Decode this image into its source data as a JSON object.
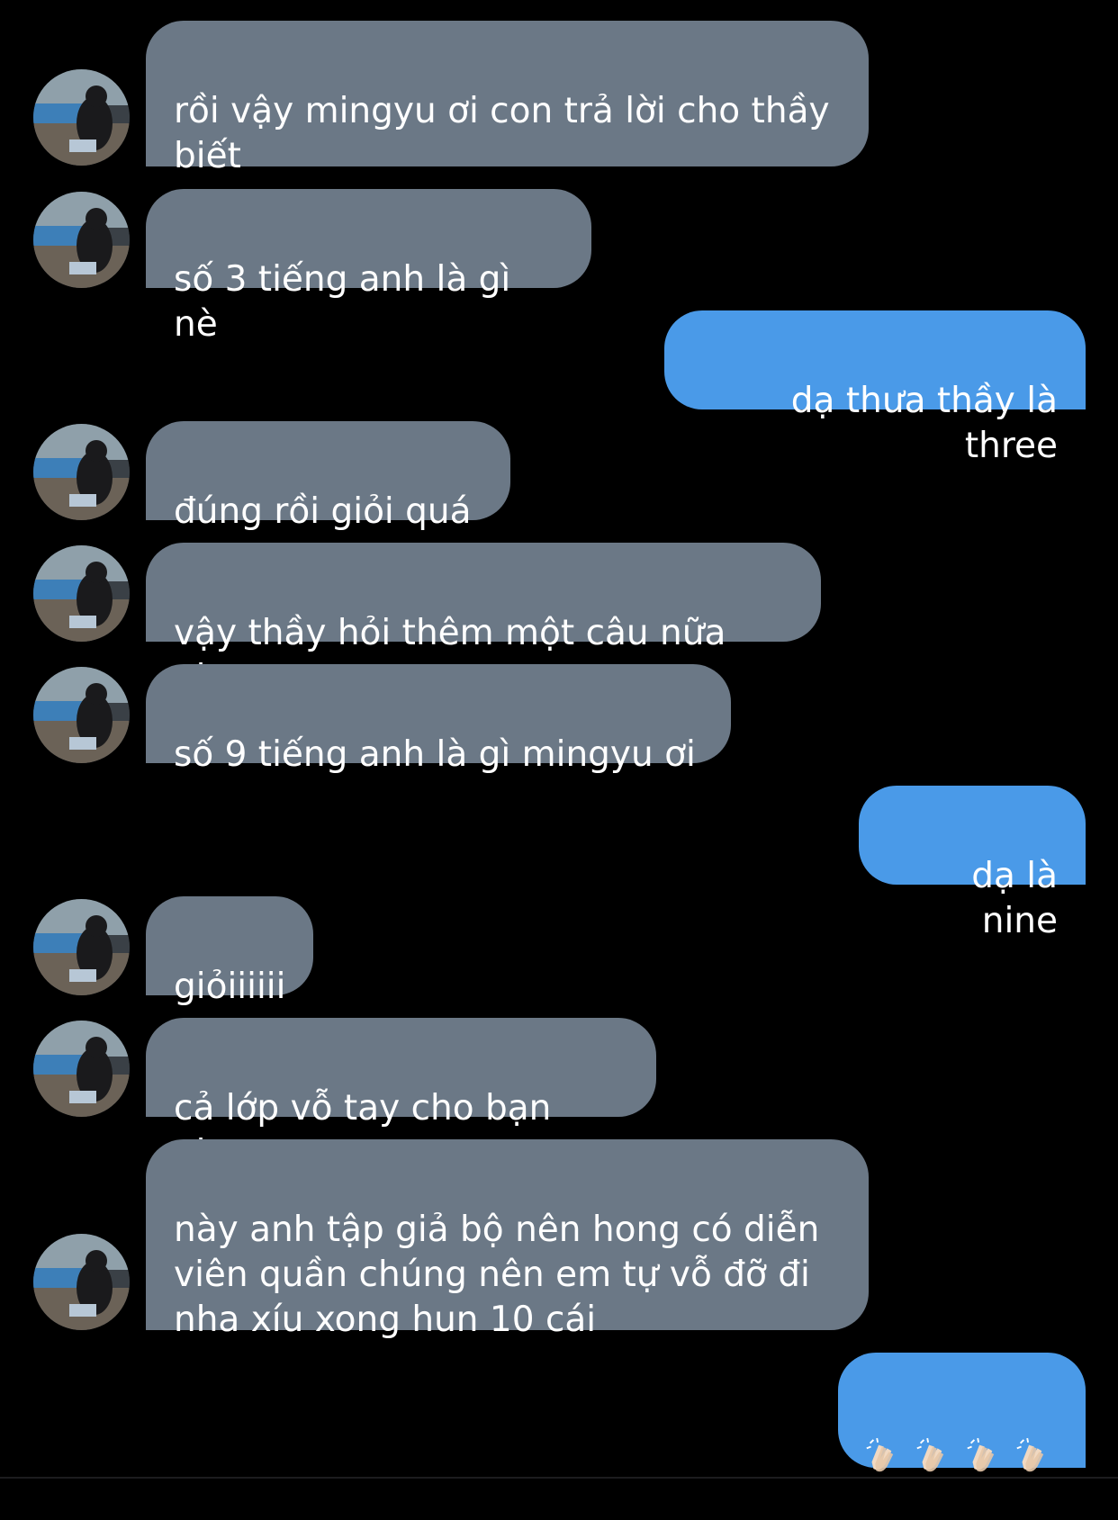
{
  "messages": [
    {
      "side": "incoming",
      "text": "rồi vậy mingyu ơi con trả lời cho thầy\nbiết"
    },
    {
      "side": "incoming",
      "text": "số 3 tiếng anh là gì nè"
    },
    {
      "side": "outgoing",
      "text": "dạ thưa thầy là three"
    },
    {
      "side": "incoming",
      "text": "đúng rồi giỏi quá"
    },
    {
      "side": "incoming",
      "text": "vậy thầy hỏi thêm một câu nữa nha"
    },
    {
      "side": "incoming",
      "text": "số 9 tiếng anh là gì mingyu ơi"
    },
    {
      "side": "outgoing",
      "text": "dạ là nine"
    },
    {
      "side": "incoming",
      "text": "giỏiiiiii"
    },
    {
      "side": "incoming",
      "text": "cả lớp vỗ tay cho bạn nha"
    },
    {
      "side": "incoming",
      "text": "này anh tập giả bộ nên hong có diễn\nviên quần chúng nên em tự vỗ đỡ đi\nnha xíu xong hun 10 cái"
    },
    {
      "side": "outgoing",
      "emoji": [
        "clapping-hands",
        "clapping-hands",
        "clapping-hands",
        "clapping-hands"
      ]
    }
  ],
  "colors": {
    "background": "#000000",
    "incoming_bubble": "#6b7886",
    "outgoing_bubble": "#4a9ae8",
    "text": "#ffffff"
  },
  "icons": {
    "avatar": "profile-photo-avatar",
    "reaction": "clapping-hands-icon"
  }
}
